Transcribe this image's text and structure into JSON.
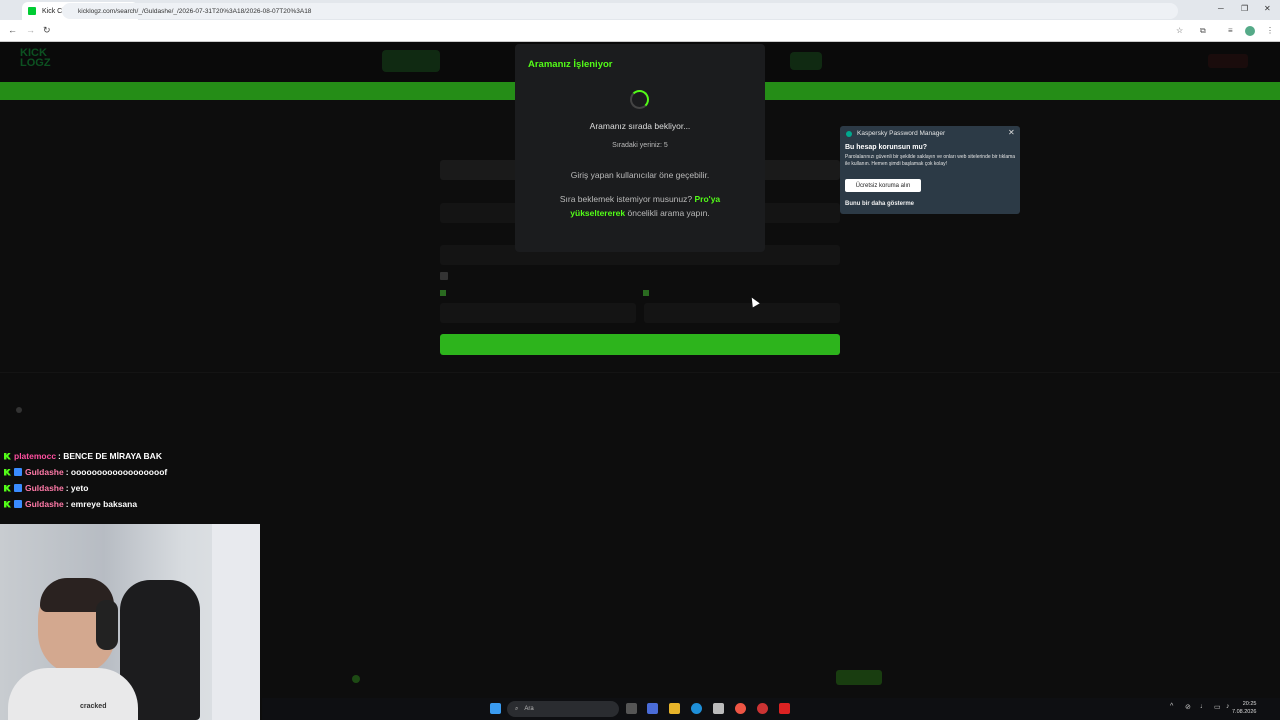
{
  "browser": {
    "tab_title": "Kick Chat Search",
    "new_tab": "+",
    "url": "kicklogz.com/search/_/Guldashe/_/2026-07-31T20%3A18/2026-08-07T20%3A18"
  },
  "modal": {
    "title": "Aramanız İşleniyor",
    "queue_text": "Aramanız sırada bekliyor...",
    "position_text": "Sıradaki yeriniz: 5",
    "login_note": "Giriş yapan kullanıcılar öne geçebilir.",
    "upgrade_prefix": "Sıra beklemek istemiyor musunuz?",
    "upgrade_link": "Pro'ya yükseltererek",
    "upgrade_suffix": "öncelikli arama yapın."
  },
  "kaspersky": {
    "title": "Kaspersky Password Manager",
    "question": "Bu hesap korunsun mu?",
    "description": "Parolalarınızı güvenli bir şekilde saklayın ve onları web sitelerinde bir tıklama ile kullanın. Hemen şimdi başlamak çok kolay!",
    "button": "Ücretsiz koruma alın",
    "never_show": "Bunu bir daha gösterme"
  },
  "chat": [
    {
      "user": "platemocc",
      "color": "#ff4fa0",
      "message": ": BENCE DE MİRAYA BAK",
      "sub": false
    },
    {
      "user": "Guldashe",
      "color": "#ff7aa8",
      "message": ": oooooooooooooooooof",
      "sub": true
    },
    {
      "user": "Guldashe",
      "color": "#ff7aa8",
      "message": ": yeto",
      "sub": true
    },
    {
      "user": "Guldashe",
      "color": "#ff7aa8",
      "message": ": emreye baksana",
      "sub": true
    }
  ],
  "webcam": {
    "shirt_text": "cracked"
  },
  "taskbar": {
    "search_placeholder": "Ara",
    "time": "20:25",
    "date": "7.08.2026"
  },
  "colors": {
    "accent": "#53fc18",
    "modal_bg": "#1b1c1e",
    "kaspersky_bg": "#2c3a46"
  }
}
